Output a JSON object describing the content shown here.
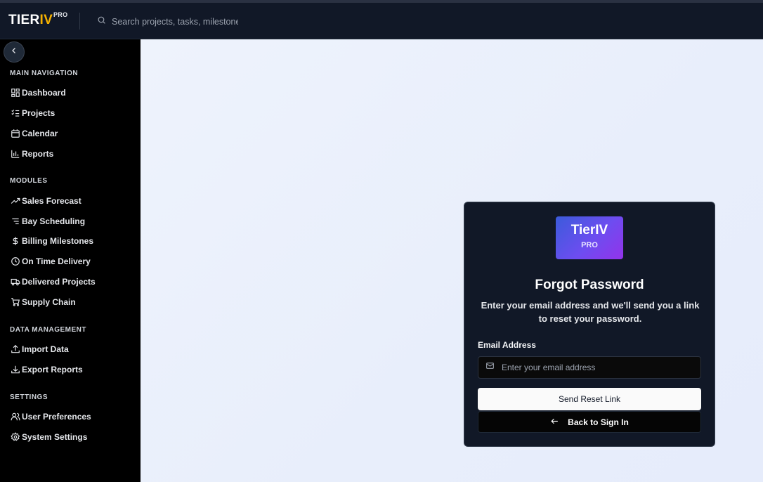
{
  "header": {
    "logo_main": "TIER",
    "logo_accent": "IV",
    "logo_badge": "PRO",
    "search_placeholder": "Search projects, tasks, milestones"
  },
  "sidebar": {
    "collapse_icon": "chevron-left-icon",
    "sections": [
      {
        "title": "MAIN NAVIGATION",
        "items": [
          {
            "label": "Dashboard",
            "icon": "dashboard-icon"
          },
          {
            "label": "Projects",
            "icon": "list-checks-icon"
          },
          {
            "label": "Calendar",
            "icon": "calendar-icon"
          },
          {
            "label": "Reports",
            "icon": "bar-chart-icon"
          }
        ]
      },
      {
        "title": "MODULES",
        "items": [
          {
            "label": "Sales Forecast",
            "icon": "trending-up-icon"
          },
          {
            "label": "Bay Scheduling",
            "icon": "list-filter-icon"
          },
          {
            "label": "Billing Milestones",
            "icon": "dollar-icon"
          },
          {
            "label": "On Time Delivery",
            "icon": "clock-icon"
          },
          {
            "label": "Delivered Projects",
            "icon": "truck-icon"
          },
          {
            "label": "Supply Chain",
            "icon": "cart-icon"
          }
        ]
      },
      {
        "title": "DATA MANAGEMENT",
        "items": [
          {
            "label": "Import Data",
            "icon": "upload-icon"
          },
          {
            "label": "Export Reports",
            "icon": "download-icon"
          }
        ]
      },
      {
        "title": "SETTINGS",
        "items": [
          {
            "label": "User Preferences",
            "icon": "users-icon"
          },
          {
            "label": "System Settings",
            "icon": "gear-icon"
          }
        ]
      }
    ]
  },
  "card": {
    "brand_name": "TierIV",
    "brand_badge": "PRO",
    "title": "Forgot Password",
    "description": "Enter your email address and we'll send you a link to reset your password.",
    "email_label": "Email Address",
    "email_placeholder": "Enter your email address",
    "email_value": "",
    "submit_label": "Send Reset Link",
    "back_label": "Back to Sign In"
  },
  "colors": {
    "header_bg": "#111827",
    "sidebar_bg": "#000000",
    "logo_accent": "#f5b100",
    "card_bg": "#111827",
    "brand_gradient_start": "#3b5bdb",
    "brand_gradient_end": "#9333ea"
  }
}
